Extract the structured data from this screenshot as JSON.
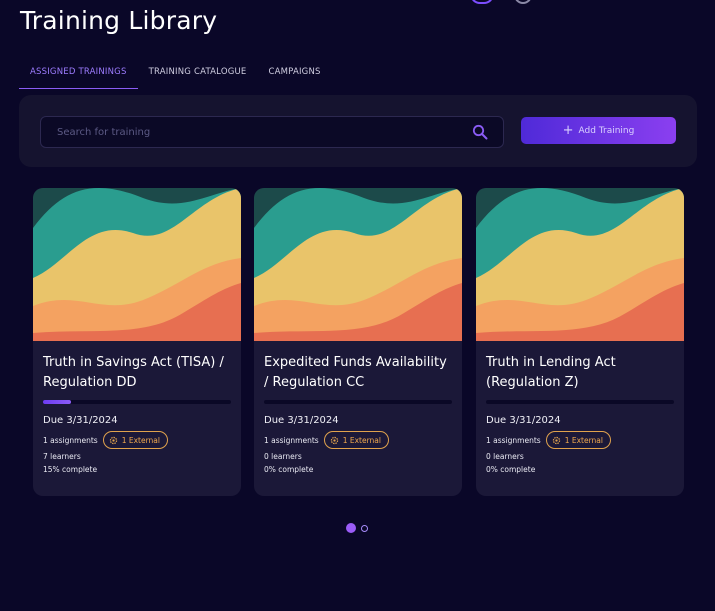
{
  "page": {
    "title": "Training Library"
  },
  "tabs": [
    {
      "label": "ASSIGNED TRAININGS",
      "active": true
    },
    {
      "label": "TRAINING CATALOGUE",
      "active": false
    },
    {
      "label": "CAMPAIGNS",
      "active": false
    }
  ],
  "search": {
    "placeholder": "Search for training",
    "value": ""
  },
  "actions": {
    "add_label": "Add Training"
  },
  "colors": {
    "accent": "#8b5cf6",
    "badge": "#e0a24d",
    "panel": "#15132f",
    "background": "#0a0728"
  },
  "cards": [
    {
      "title": "Truth in Savings Act (TISA) / Regulation DD",
      "progress": 0.15,
      "due": "Due 3/31/2024",
      "assignments": "1 assignments",
      "external": "1 External",
      "learners": "7 learners",
      "complete": "15% complete"
    },
    {
      "title": "Expedited Funds Availability / Regulation CC",
      "progress": 0,
      "due": "Due 3/31/2024",
      "assignments": "1 assignments",
      "external": "1 External",
      "learners": "0 learners",
      "complete": "0% complete"
    },
    {
      "title": "Truth in Lending Act (Regulation Z)",
      "progress": 0,
      "due": "Due 3/31/2024",
      "assignments": "1 assignments",
      "external": "1 External",
      "learners": "0 learners",
      "complete": "0% complete"
    }
  ],
  "pagination": {
    "pages": 2,
    "current": 1
  }
}
